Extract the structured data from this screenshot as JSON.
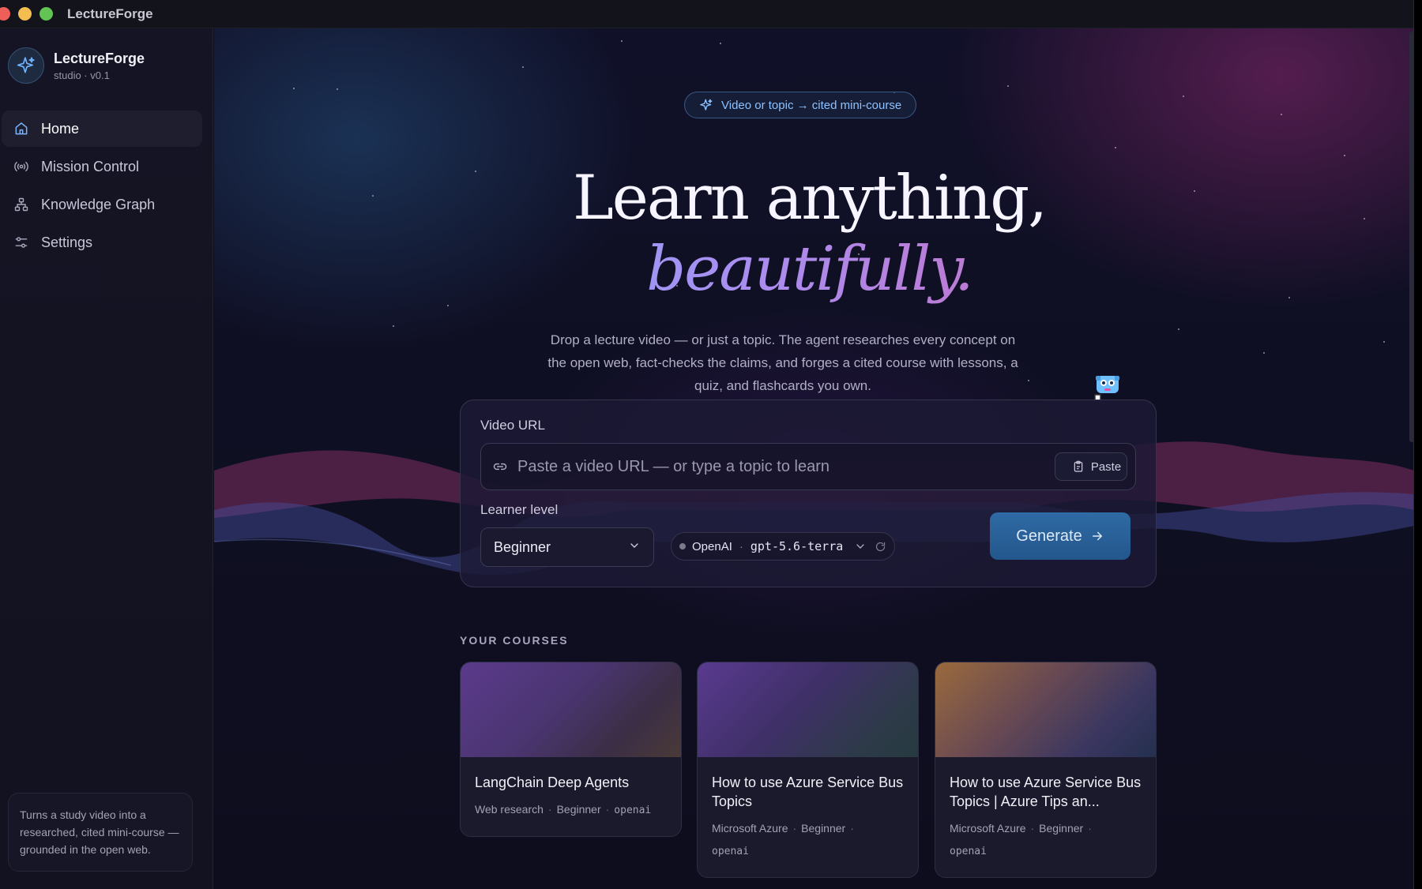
{
  "window": {
    "title": "LectureForge"
  },
  "sidebar": {
    "brand_name": "LectureForge",
    "brand_sub": "studio · v0.1",
    "items": [
      {
        "label": "Home",
        "icon": "home-icon",
        "active": true
      },
      {
        "label": "Mission Control",
        "icon": "broadcast-icon",
        "active": false
      },
      {
        "label": "Knowledge Graph",
        "icon": "hierarchy-icon",
        "active": false
      },
      {
        "label": "Settings",
        "icon": "sliders-icon",
        "active": false
      }
    ],
    "note": "Turns a study video into a researched, cited mini-course — grounded in the open web."
  },
  "hero": {
    "pill": "Video or topic → cited mini-course",
    "title_line1": "Learn anything,",
    "title_line2": "beautifully.",
    "description": "Drop a lecture video — or just a topic. The agent researches every concept on the open web, fact-checks the claims, and forges a cited course with lessons, a quiz, and flashcards you own."
  },
  "form": {
    "url_label": "Video URL",
    "url_placeholder": "Paste a video URL — or type a topic to learn",
    "url_value": "",
    "paste_label": "Paste",
    "level_label": "Learner level",
    "level_value": "Beginner",
    "provider": "OpenAI",
    "model": "gpt-5.6-terra",
    "generate_label": "Generate"
  },
  "courses": {
    "heading": "YOUR COURSES",
    "items": [
      {
        "title": "LangChain Deep Agents",
        "source": "Web research",
        "level": "Beginner",
        "provider": "openai"
      },
      {
        "title": "How to use Azure Service Bus Topics",
        "source": "Microsoft Azure",
        "level": "Beginner",
        "provider": "openai"
      },
      {
        "title": "How to use Azure Service Bus Topics | Azure Tips an...",
        "source": "Microsoft Azure",
        "level": "Beginner",
        "provider": "openai"
      }
    ]
  },
  "colors": {
    "accent": "#2f6aa4",
    "pill_text": "#8ec2ff",
    "gradient_start": "#7cb2ff",
    "gradient_end": "#e0559e"
  }
}
